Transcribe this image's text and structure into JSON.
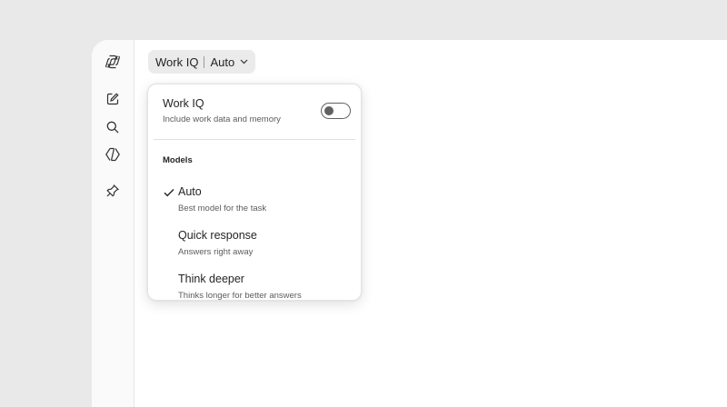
{
  "sidebar": {
    "items": [
      {
        "icon": "copilot-logo-icon"
      },
      {
        "icon": "new-chat-icon"
      },
      {
        "icon": "search-icon"
      },
      {
        "icon": "agents-icon"
      },
      {
        "icon": "pin-icon"
      }
    ]
  },
  "model_picker": {
    "mode_label": "Work IQ",
    "selected_model": "Auto"
  },
  "dropdown": {
    "work_iq": {
      "title": "Work IQ",
      "description": "Include work data and memory",
      "enabled": false
    },
    "models_heading": "Models",
    "models": [
      {
        "name": "Auto",
        "description": "Best model for the task",
        "selected": true
      },
      {
        "name": "Quick response",
        "description": "Answers right away",
        "selected": false
      },
      {
        "name": "Think deeper",
        "description": "Thinks longer for better answers",
        "selected": false
      }
    ]
  },
  "colors": {
    "page_background": "#e9e9e9",
    "picker_background": "#ebebeb",
    "toggle_off": "#616161"
  }
}
